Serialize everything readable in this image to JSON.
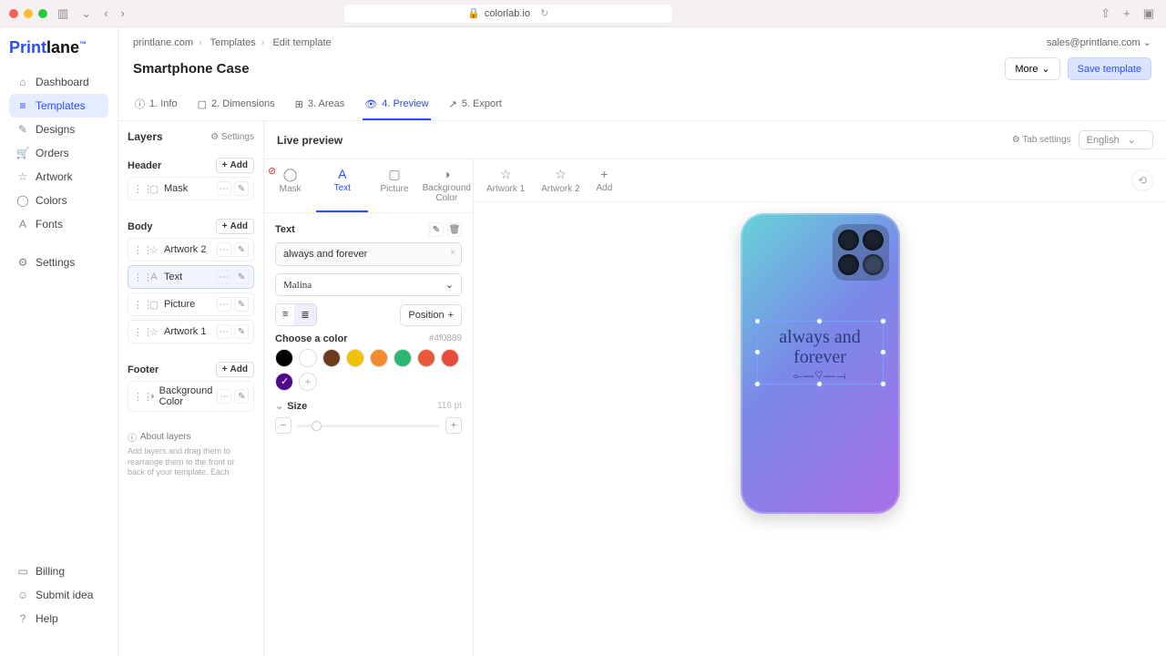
{
  "browser": {
    "url_host": "colorlab.io",
    "lock": "🔒"
  },
  "brand": {
    "part1": "Print",
    "part2": "lane"
  },
  "nav": {
    "main": [
      {
        "icon": "⌂",
        "label": "Dashboard"
      },
      {
        "icon": "≡",
        "label": "Templates",
        "active": true
      },
      {
        "icon": "✎",
        "label": "Designs"
      },
      {
        "icon": "🛒",
        "label": "Orders"
      },
      {
        "icon": "☆",
        "label": "Artwork"
      },
      {
        "icon": "◯",
        "label": "Colors"
      },
      {
        "icon": "A",
        "label": "Fonts"
      }
    ],
    "settings": [
      {
        "icon": "⚙",
        "label": "Settings"
      }
    ],
    "footer": [
      {
        "icon": "▭",
        "label": "Billing"
      },
      {
        "icon": "☺",
        "label": "Submit idea"
      },
      {
        "icon": "?",
        "label": "Help"
      }
    ]
  },
  "breadcrumb": [
    "printlane.com",
    "Templates",
    "Edit template"
  ],
  "user_email": "sales@printlane.com",
  "page_title": "Smartphone Case",
  "title_actions": {
    "more": "More",
    "save": "Save template"
  },
  "steps": [
    {
      "icon": "ⓘ",
      "label": "1. Info"
    },
    {
      "icon": "▢",
      "label": "2. Dimensions"
    },
    {
      "icon": "⊞",
      "label": "3. Areas"
    },
    {
      "icon": "👁",
      "label": "4. Preview",
      "active": true
    },
    {
      "icon": "↗",
      "label": "5. Export"
    }
  ],
  "layers": {
    "title": "Layers",
    "settings_link": "⚙ Settings",
    "add_label": "Add",
    "groups": [
      {
        "name": "Header",
        "items": [
          {
            "icon": "▢",
            "label": "Mask"
          }
        ]
      },
      {
        "name": "Body",
        "items": [
          {
            "icon": "☆",
            "label": "Artwork 2"
          },
          {
            "icon": "A",
            "label": "Text",
            "selected": true
          },
          {
            "icon": "▢",
            "label": "Picture"
          },
          {
            "icon": "☆",
            "label": "Artwork 1"
          }
        ]
      },
      {
        "name": "Footer",
        "items": [
          {
            "icon": "◑",
            "label": "Background Color"
          }
        ]
      }
    ],
    "about_title": "About layers",
    "about_text": "Add layers and drag them to rearrange them to the front or back of your template. Each"
  },
  "editor": {
    "title": "Live preview",
    "tab_settings": "⚙ Tab settings",
    "language": "English",
    "tool_tabs": [
      {
        "icon": "◯",
        "label": "Mask"
      },
      {
        "icon": "A",
        "label": "Text",
        "active": true
      },
      {
        "icon": "▢",
        "label": "Picture"
      },
      {
        "icon": "◑",
        "label": "Background Color"
      }
    ],
    "extra_tabs": [
      {
        "icon": "☆",
        "label": "Artwork 1"
      },
      {
        "icon": "☆",
        "label": "Artwork 2"
      },
      {
        "icon": "+",
        "label": "Add"
      }
    ],
    "text_section": "Text",
    "text_value": "always and forever",
    "font_name": "Malina",
    "position_label": "Position",
    "color_label": "Choose a color",
    "color_hex": "#4f0889",
    "swatches": [
      "#000000",
      "#ffffff",
      "#6b3a1f",
      "#f2c200",
      "#f08c2e",
      "#2bb673",
      "#e85a3a",
      "#e84b3a",
      "#4f0889"
    ],
    "selected_swatch": 8,
    "size_label": "Size",
    "size_value": "116 pt"
  },
  "preview_text": {
    "line1": "always and",
    "line2": "forever"
  }
}
